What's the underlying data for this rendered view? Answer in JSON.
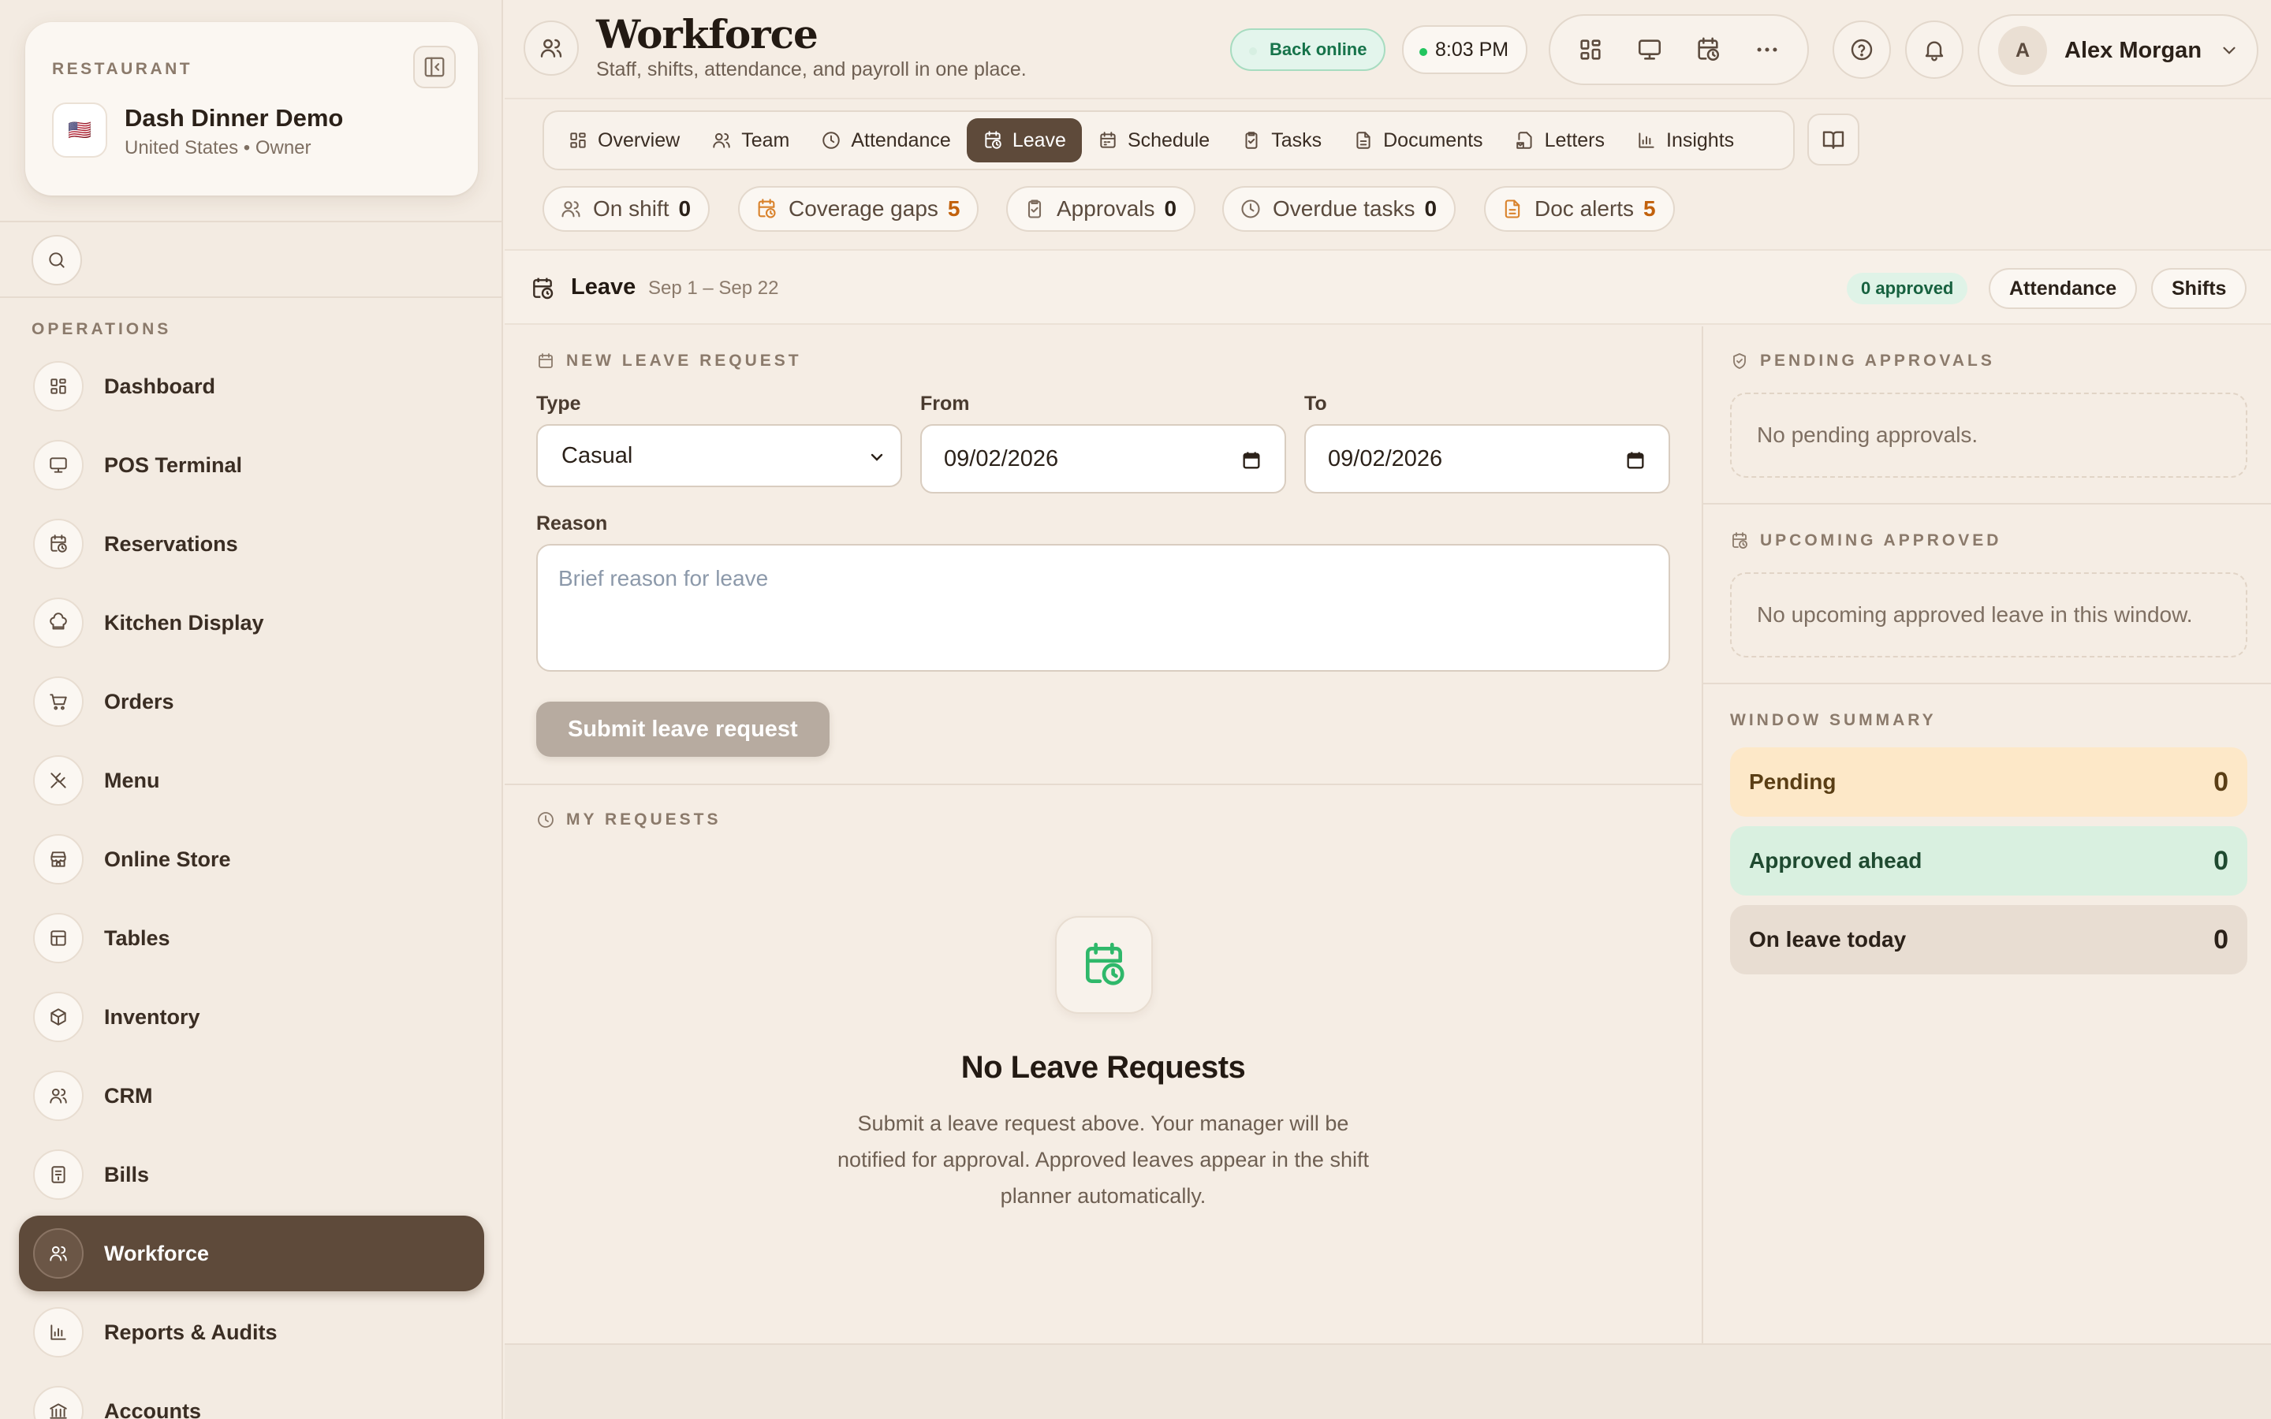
{
  "sidebar": {
    "eyebrow": "RESTAURANT",
    "restaurant_name": "Dash Dinner Demo",
    "restaurant_sub": "United States • Owner",
    "flag": "🇺🇸",
    "section_title": "OPERATIONS",
    "items": [
      {
        "label": "Dashboard",
        "icon": "grid-icon"
      },
      {
        "label": "POS Terminal",
        "icon": "monitor-icon"
      },
      {
        "label": "Reservations",
        "icon": "calendar-clock-icon"
      },
      {
        "label": "Kitchen Display",
        "icon": "chef-hat-icon"
      },
      {
        "label": "Orders",
        "icon": "cart-icon"
      },
      {
        "label": "Menu",
        "icon": "utensils-icon"
      },
      {
        "label": "Online Store",
        "icon": "store-icon"
      },
      {
        "label": "Tables",
        "icon": "table-icon"
      },
      {
        "label": "Inventory",
        "icon": "box-icon"
      },
      {
        "label": "CRM",
        "icon": "users-icon"
      },
      {
        "label": "Bills",
        "icon": "receipt-icon"
      },
      {
        "label": "Workforce",
        "icon": "users-icon",
        "active": true
      },
      {
        "label": "Reports & Audits",
        "icon": "bar-chart-icon"
      },
      {
        "label": "Accounts",
        "icon": "bank-icon"
      }
    ]
  },
  "header": {
    "title": "Workforce",
    "subtitle": "Staff, shifts, attendance, and payroll in one place.",
    "status": "Back online",
    "time": "8:03 PM",
    "user_initial": "A",
    "user_name": "Alex Morgan"
  },
  "tabs": [
    {
      "label": "Overview",
      "icon": "grid-icon"
    },
    {
      "label": "Team",
      "icon": "users-icon"
    },
    {
      "label": "Attendance",
      "icon": "clock-icon"
    },
    {
      "label": "Leave",
      "icon": "calendar-clock-icon",
      "active": true
    },
    {
      "label": "Schedule",
      "icon": "calendar-icon"
    },
    {
      "label": "Tasks",
      "icon": "clipboard-check-icon"
    },
    {
      "label": "Documents",
      "icon": "document-icon"
    },
    {
      "label": "Letters",
      "icon": "letter-icon"
    },
    {
      "label": "Insights",
      "icon": "bar-chart-icon"
    }
  ],
  "stats": [
    {
      "label": "On shift",
      "value": "0",
      "icon": "users-icon",
      "warn": false
    },
    {
      "label": "Coverage gaps",
      "value": "5",
      "icon": "calendar-clock-icon",
      "warn": true
    },
    {
      "label": "Approvals",
      "value": "0",
      "icon": "clipboard-check-icon",
      "warn": false
    },
    {
      "label": "Overdue tasks",
      "value": "0",
      "icon": "clock-icon",
      "warn": false
    },
    {
      "label": "Doc alerts",
      "value": "5",
      "icon": "document-icon",
      "warn": true
    }
  ],
  "leave_bar": {
    "title": "Leave",
    "range": "Sep 1 – Sep 22",
    "approved_badge": "0 approved",
    "attendance_btn": "Attendance",
    "shifts_btn": "Shifts"
  },
  "form": {
    "eyebrow": "NEW LEAVE REQUEST",
    "type_label": "Type",
    "type_value": "Casual",
    "from_label": "From",
    "from_value": "09/02/2026",
    "to_label": "To",
    "to_value": "09/02/2026",
    "reason_label": "Reason",
    "reason_placeholder": "Brief reason for leave",
    "submit_label": "Submit leave request"
  },
  "my_requests": {
    "eyebrow": "MY REQUESTS",
    "empty_title": "No Leave Requests",
    "empty_text": "Submit a leave request above. Your manager will be notified for approval. Approved leaves appear in the shift planner automatically."
  },
  "right": {
    "pending_eyebrow": "PENDING APPROVALS",
    "pending_empty": "No pending approvals.",
    "upcoming_eyebrow": "UPCOMING APPROVED",
    "upcoming_empty": "No upcoming approved leave in this window.",
    "summary_eyebrow": "WINDOW SUMMARY",
    "summary": [
      {
        "label": "Pending",
        "value": "0",
        "bg": "#fde8c8",
        "fg": "#5a3e15"
      },
      {
        "label": "Approved ahead",
        "value": "0",
        "bg": "#d9f0e0",
        "fg": "#1f4a30"
      },
      {
        "label": "On leave today",
        "value": "0",
        "bg": "#e8ddd2",
        "fg": "#2b2119"
      }
    ]
  },
  "colors": {
    "accent": "#5e4a3a",
    "background": "#f5ede4",
    "warn": "#c2610c",
    "success": "#16734a"
  }
}
